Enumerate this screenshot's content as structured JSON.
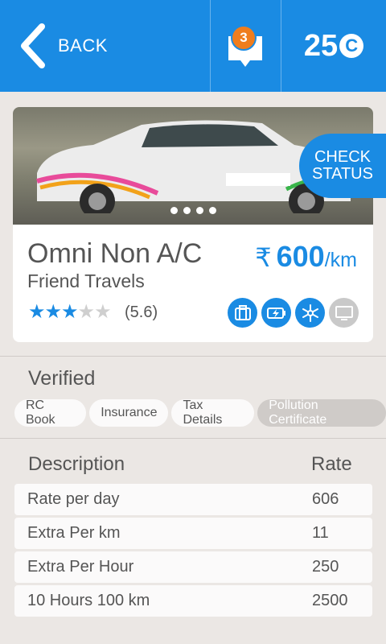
{
  "header": {
    "back_label": "BACK",
    "notifications_count": "3",
    "coins": "25",
    "coin_symbol": "C",
    "color": "#1a8be3",
    "badge_color": "#ef7d1d"
  },
  "vehicle": {
    "name": "Omni Non A/C",
    "operator": "Friend Travels",
    "price_currency": "₹",
    "price": "600",
    "price_unit": "/km",
    "rating_stars": 3,
    "rating_max": 5,
    "rating_text": "(5.6)",
    "carousel_pages": 4,
    "check_status": [
      "CHECK",
      "STATUS"
    ],
    "features": [
      {
        "icon": "luggage-icon",
        "enabled": true
      },
      {
        "icon": "charging-icon",
        "enabled": true
      },
      {
        "icon": "ac-snowflake-icon",
        "enabled": true
      },
      {
        "icon": "tv-icon",
        "enabled": false
      }
    ]
  },
  "verified": {
    "heading": "Verified",
    "documents": [
      {
        "label": "RC Book",
        "verified": true
      },
      {
        "label": "Insurance",
        "verified": true
      },
      {
        "label": "Tax Details",
        "verified": true
      },
      {
        "label": "Pollution Certificate",
        "verified": false
      }
    ]
  },
  "rates": {
    "headers": {
      "description": "Description",
      "rate": "Rate"
    },
    "rows": [
      {
        "description": "Rate per day",
        "rate": "606"
      },
      {
        "description": "Extra Per km",
        "rate": "11"
      },
      {
        "description": "Extra Per Hour",
        "rate": "250"
      },
      {
        "description": "10 Hours 100 km",
        "rate": "2500"
      }
    ]
  }
}
